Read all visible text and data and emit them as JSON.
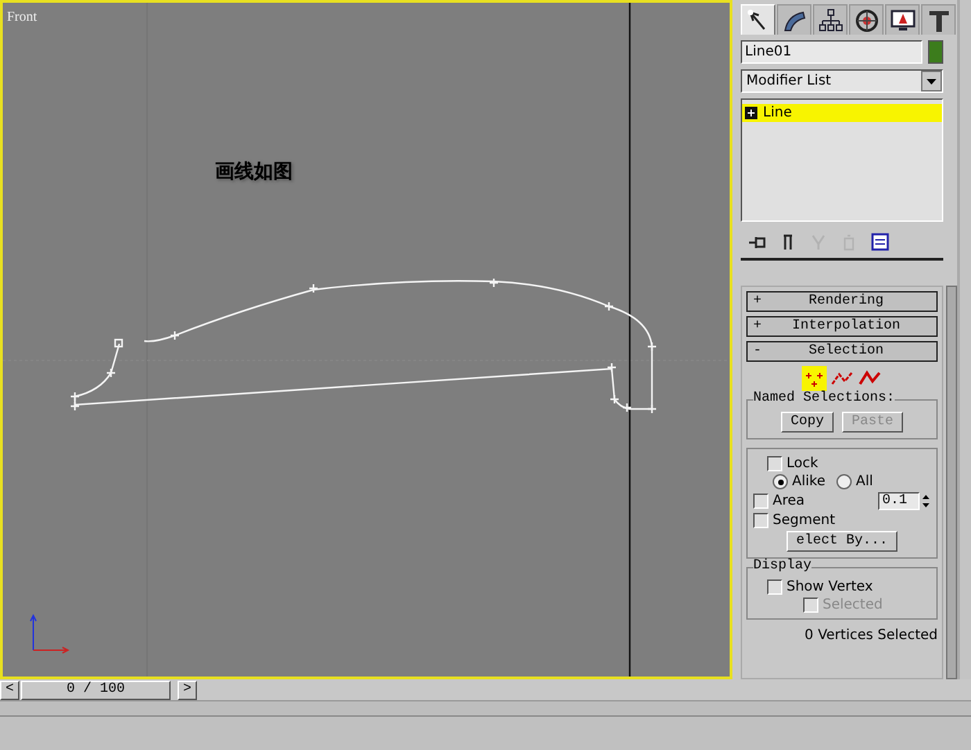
{
  "viewport": {
    "label": "Front",
    "annotation": "画线如图",
    "active": true
  },
  "time_slider": {
    "prev": "<",
    "position": "0 / 100",
    "level": 0,
    "next": ">"
  },
  "command_panel": {
    "tabs": [
      {
        "kind": "create",
        "selected": true
      },
      {
        "kind": "modify",
        "selected": false
      },
      {
        "kind": "hierarchy",
        "selected": false
      },
      {
        "kind": "motion",
        "selected": false
      },
      {
        "kind": "display",
        "selected": false
      },
      {
        "kind": "utilities",
        "selected": false
      }
    ],
    "object_name": "Line01",
    "modifier_list": "Modifier List",
    "stack": [
      {
        "label": "Line",
        "selected": true
      }
    ],
    "stack_tools": [
      {
        "kind": "pin",
        "disabled": false
      },
      {
        "kind": "show-end",
        "disabled": false
      },
      {
        "kind": "unique",
        "disabled": true
      },
      {
        "kind": "remove",
        "disabled": true
      },
      {
        "kind": "configure",
        "disabled": false
      }
    ],
    "rollouts": [
      {
        "sign": "+",
        "title": "Rendering",
        "kind": "rendering"
      },
      {
        "sign": "+",
        "title": "Interpolation",
        "kind": "interpolation"
      },
      {
        "sign": "-",
        "title": "Selection",
        "kind": "selection"
      }
    ],
    "selection": {
      "levels": [
        {
          "kind": "vertex",
          "selected": true
        },
        {
          "kind": "segment",
          "selected": false
        },
        {
          "kind": "spline",
          "selected": false
        }
      ],
      "named_selections": {
        "title": "Named Selections:",
        "buttons": [
          {
            "label": "Copy",
            "disabled": false
          },
          {
            "label": "Paste",
            "disabled": true
          }
        ]
      },
      "lock_handles": {
        "label": "Lock",
        "checked": false,
        "options": [
          {
            "label": "Alike",
            "selected": true
          },
          {
            "label": "All",
            "selected": false
          }
        ]
      },
      "area": {
        "label": "Area",
        "checked": false,
        "value": "0.1"
      },
      "segment": {
        "label": "Segment",
        "checked": false
      },
      "select_by": "elect By...",
      "display": {
        "title": "Display",
        "show_vertex": {
          "label": "Show Vertex",
          "checked": false
        },
        "selected": {
          "label": "Selected",
          "checked": false,
          "disabled": true
        }
      },
      "status": "0 Vertices Selected"
    }
  }
}
